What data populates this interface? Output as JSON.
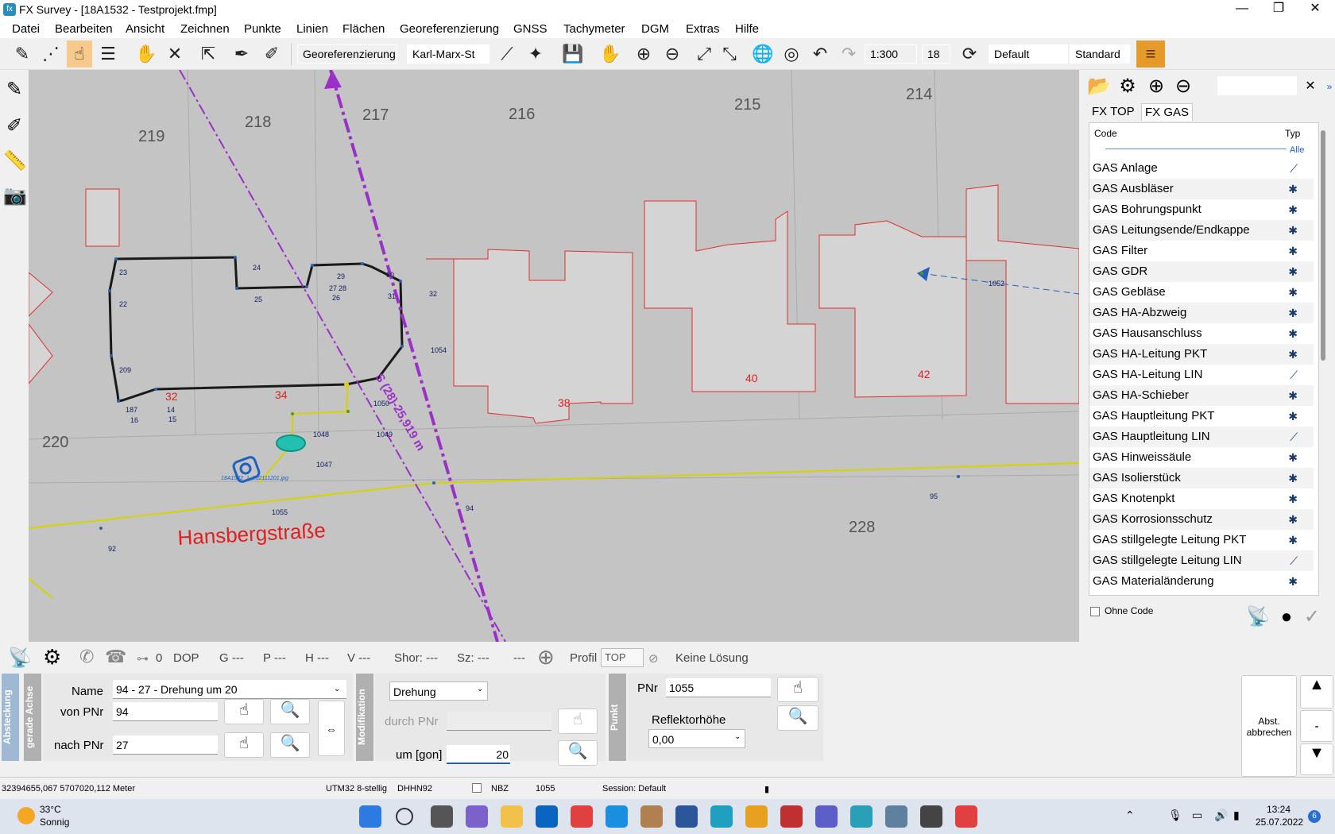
{
  "window": {
    "title": "FX Survey - [18A1532 - Testprojekt.fmp]",
    "logo": "fx",
    "minimize": "—",
    "maximize": "❐",
    "close": "✕"
  },
  "menu": [
    "Datei",
    "Bearbeiten",
    "Ansicht",
    "Zeichnen",
    "Punkte",
    "Linien",
    "Flächen",
    "Georeferenzierung",
    "GNSS",
    "Tachymeter",
    "DGM",
    "Extras",
    "Hilfe"
  ],
  "toolbar": {
    "georef_label": "Georeferenzierung",
    "street_select": "Karl-Marx-St",
    "scale_select": "1:300",
    "size_select": "18",
    "style_select_1": "Default",
    "style_select_2": "Standard"
  },
  "map": {
    "parcel_numbers": [
      "219",
      "218",
      "217",
      "216",
      "215",
      "214",
      "220",
      "228"
    ],
    "house_numbers": [
      "32",
      "34",
      "38",
      "40",
      "42"
    ],
    "street_name": "Hansbergstraße",
    "points": [
      "23",
      "24",
      "22",
      "25",
      "29",
      "30",
      "28",
      "26",
      "27",
      "31",
      "32",
      "1054",
      "209",
      "187",
      "14",
      "15",
      "16",
      "1050",
      "1048",
      "1049",
      "1047",
      "92",
      "94",
      "95",
      "1052",
      "1055"
    ],
    "measure_label": "S (28)-25,919 m",
    "photo_label": "18A1532_1_202111201.jpg"
  },
  "right_panel": {
    "tabs": [
      "FX TOP",
      "FX GAS"
    ],
    "active_tab": "FX GAS",
    "col_code": "Code",
    "col_typ": "Typ",
    "filter_all": "Alle",
    "codes": [
      {
        "name": "GAS Anlage",
        "typ": "line"
      },
      {
        "name": "GAS Ausbläser",
        "typ": "point"
      },
      {
        "name": "GAS Bohrungspunkt",
        "typ": "point"
      },
      {
        "name": "GAS Leitungsende/Endkappe",
        "typ": "point"
      },
      {
        "name": "GAS Filter",
        "typ": "point"
      },
      {
        "name": "GAS GDR",
        "typ": "point"
      },
      {
        "name": "GAS Gebläse",
        "typ": "point"
      },
      {
        "name": "GAS HA-Abzweig",
        "typ": "point"
      },
      {
        "name": "GAS Hausanschluss",
        "typ": "point"
      },
      {
        "name": "GAS HA-Leitung PKT",
        "typ": "point"
      },
      {
        "name": "GAS HA-Leitung LIN",
        "typ": "line"
      },
      {
        "name": "GAS HA-Schieber",
        "typ": "point"
      },
      {
        "name": "GAS Hauptleitung PKT",
        "typ": "point"
      },
      {
        "name": "GAS Hauptleitung LIN",
        "typ": "line"
      },
      {
        "name": "GAS Hinweissäule",
        "typ": "point"
      },
      {
        "name": "GAS Isolierstück",
        "typ": "point"
      },
      {
        "name": "GAS Knotenpkt",
        "typ": "point"
      },
      {
        "name": "GAS Korrosionsschutz",
        "typ": "point"
      },
      {
        "name": "GAS stillgelegte Leitung PKT",
        "typ": "point"
      },
      {
        "name": "GAS stillgelegte Leitung LIN",
        "typ": "line"
      },
      {
        "name": "GAS Materialänderung",
        "typ": "point"
      }
    ],
    "ohne_code": "Ohne Code"
  },
  "gnss": {
    "count": "0",
    "dop": "DOP",
    "g": "G ---",
    "p": "P ---",
    "h": "H ---",
    "v": "V ---",
    "shor": "Shor: ---",
    "sz": "Sz: ---",
    "dash": "---",
    "profil": "Profil",
    "profil_value": "TOP",
    "solution": "Keine Lösung"
  },
  "absteckung": {
    "tab1": "Absteckung",
    "tab2": "gerade Achse",
    "name_label": "Name",
    "name_value": "94 - 27 - Drehung um 20",
    "von_label": "von PNr",
    "von_value": "94",
    "nach_label": "nach PNr",
    "nach_value": "27"
  },
  "modifikation": {
    "tab": "Modifikation",
    "mode": "Drehung",
    "durch_label": "durch PNr",
    "durch_value": "",
    "um_label": "um [gon]",
    "um_value": "20"
  },
  "punkt": {
    "tab": "Punkt",
    "pnr_label": "PNr",
    "pnr_value": "1055",
    "refl_label": "Reflektorhöhe",
    "refl_value": "0,00",
    "abort_label": "Abst. abbrechen",
    "minus": "-"
  },
  "status": {
    "coords": "32394655,067 5707020,112 Meter",
    "crs": "UTM32 8-stellig",
    "height": "DHHN92",
    "nbz": "NBZ",
    "point": "1055",
    "session": "Session: Default"
  },
  "taskbar": {
    "temp": "33°C",
    "weather": "Sonnig",
    "time": "13:24",
    "date": "25.07.2022",
    "badge": "6"
  }
}
